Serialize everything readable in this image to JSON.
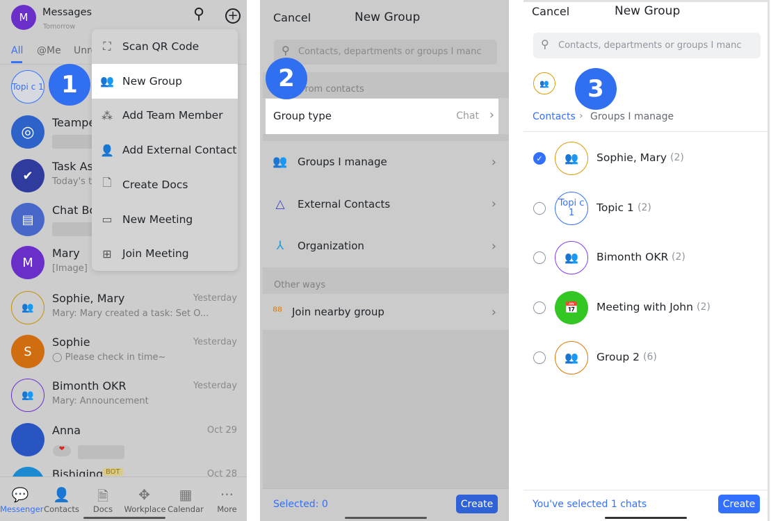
{
  "colors": {
    "accent": "#3370ff",
    "step_badge": "#2f6ff0"
  },
  "steps": [
    "1",
    "2",
    "3"
  ],
  "messenger": {
    "avatar_letter": "M",
    "title": "Messages",
    "subtitle": "Tomorrow",
    "tabs": [
      "All",
      "@Me",
      "Unre"
    ],
    "menu": [
      {
        "label": "Scan QR Code",
        "icon": "scan-icon"
      },
      {
        "label": "New Group",
        "icon": "new-group-icon"
      },
      {
        "label": "Add Team Member",
        "icon": "add-team-member-icon"
      },
      {
        "label": "Add External Contact",
        "icon": "add-contact-icon"
      },
      {
        "label": "Create Docs",
        "icon": "create-doc-icon"
      },
      {
        "label": "New Meeting",
        "icon": "video-icon"
      },
      {
        "label": "Join Meeting",
        "icon": "join-meeting-icon"
      }
    ],
    "chats": [
      {
        "avatar": "Topi c 1",
        "name": "",
        "preview": "",
        "time": ""
      },
      {
        "avatar": "",
        "name": "Teampe",
        "preview": "",
        "time": ""
      },
      {
        "avatar": "",
        "name": "Task Ass",
        "preview": "Today's t",
        "time": ""
      },
      {
        "avatar": "",
        "name": "Chat Bo",
        "preview": "",
        "time": ""
      },
      {
        "avatar": "M",
        "name": "Mary",
        "preview": "[Image]",
        "time": ""
      },
      {
        "avatar": "",
        "name": "Sophie, Mary",
        "preview": "Mary: Mary created a task: Set O...",
        "time": "Yesterday"
      },
      {
        "avatar": "S",
        "name": "Sophie",
        "preview": "◯ Please check in time~",
        "time": "Yesterday"
      },
      {
        "avatar": "",
        "name": "Bimonth OKR",
        "preview": "Mary: Announcement",
        "time": "Yesterday"
      },
      {
        "avatar": "",
        "name": "Anna",
        "preview": "❤",
        "time": "Oct 29"
      },
      {
        "avatar": "",
        "name": "Bishiqing",
        "preview": "",
        "time": "Oct 28",
        "tag": "BOT"
      }
    ],
    "nav": [
      "Messenger",
      "Contacts",
      "Docs",
      "Workplace",
      "Calendar",
      "More"
    ],
    "calendar_day": "2"
  },
  "new_group": {
    "cancel": "Cancel",
    "title": "New Group",
    "search_placeholder": "Contacts, departments or groups I manc",
    "section_from": "From contacts",
    "group_type_label": "Group type",
    "group_type_value": "Chat",
    "sources": [
      {
        "label": "Groups I manage",
        "icon": "groups-icon",
        "color": "#2ea121"
      },
      {
        "label": "External Contacts",
        "icon": "external-contacts-icon",
        "color": "#3b43c8"
      },
      {
        "label": "Organization",
        "icon": "organization-icon",
        "color": "#1e9bd6"
      }
    ],
    "section_other": "Other ways",
    "join_nearby": "Join nearby group",
    "selected": "Selected: 0",
    "create": "Create"
  },
  "groups_manage": {
    "cancel": "Cancel",
    "title": "New Group",
    "search_placeholder": "Contacts, departments or groups I manc",
    "breadcrumb": [
      "Contacts",
      "Groups I manage"
    ],
    "groups": [
      {
        "name": "Sophie, Mary",
        "count": "(2)",
        "checked": true,
        "avatar": "",
        "color": "#dc9b04",
        "style": "ring"
      },
      {
        "name": "Topic 1",
        "count": "(2)",
        "checked": false,
        "avatar": "Topi c 1",
        "color": "#3370ff",
        "style": "ring"
      },
      {
        "name": "Bimonth OKR",
        "count": "(2)",
        "checked": false,
        "avatar": "",
        "color": "#7f3bf5",
        "style": "ring"
      },
      {
        "name": "Meeting with John",
        "count": "(2)",
        "checked": false,
        "avatar": "",
        "color": "#34c724",
        "style": "fill"
      },
      {
        "name": "Group 2",
        "count": "(6)",
        "checked": false,
        "avatar": "",
        "color": "#de7802",
        "style": "ring"
      }
    ],
    "selected": "You've selected 1 chats",
    "create": "Create"
  }
}
